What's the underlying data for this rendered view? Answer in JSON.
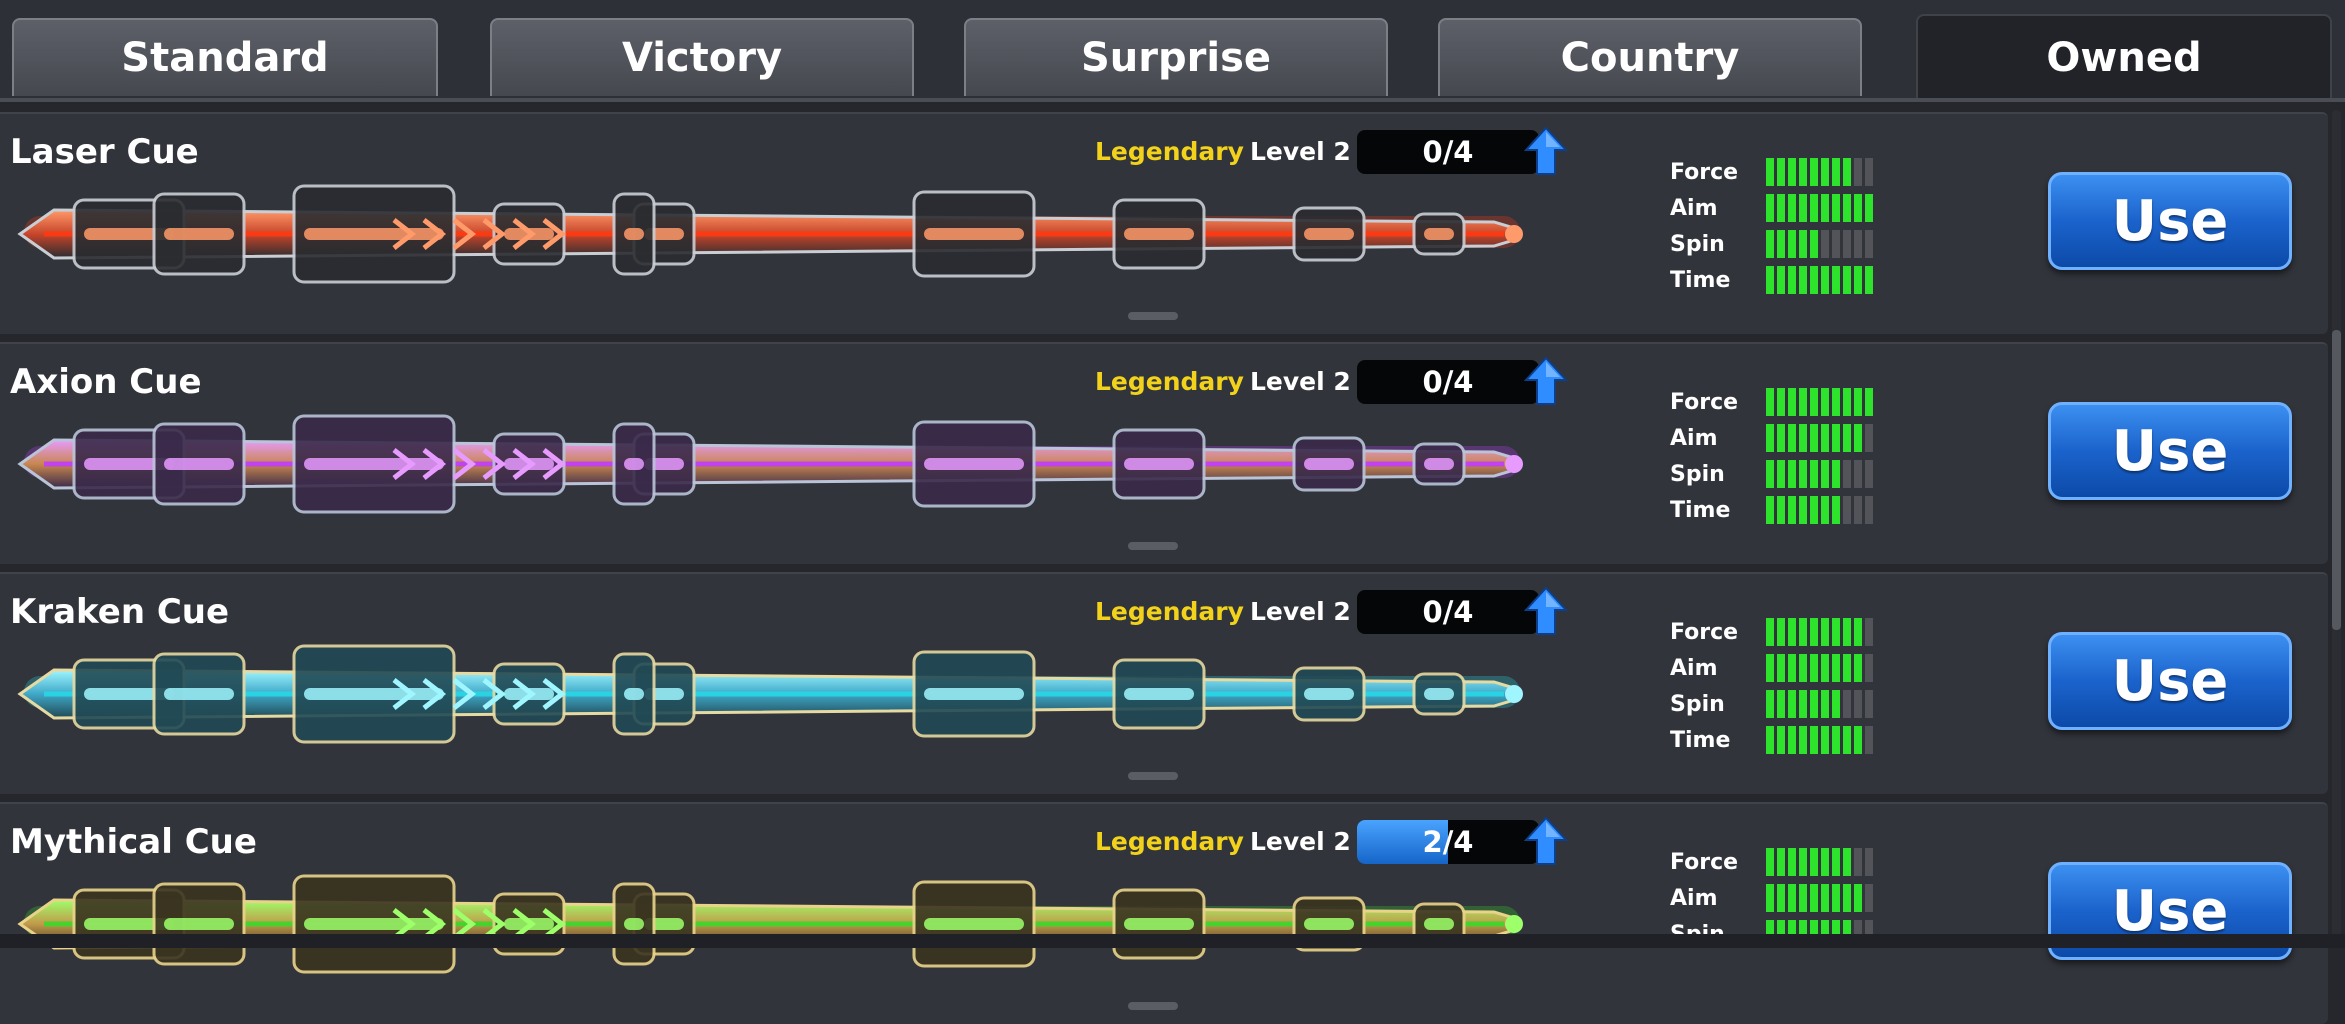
{
  "tabs": [
    {
      "label": "Standard"
    },
    {
      "label": "Victory"
    },
    {
      "label": "Surprise"
    },
    {
      "label": "Country"
    },
    {
      "label": "Owned",
      "active": true
    }
  ],
  "stat_labels": [
    "Force",
    "Aim",
    "Spin",
    "Time"
  ],
  "cues": [
    {
      "name": "Laser Cue",
      "rarity": "Legendary",
      "level": "Level 2",
      "progress": "0/4",
      "progress_fraction": 0.0,
      "stats": {
        "Force": 8,
        "Aim": 10,
        "Spin": 5,
        "Time": 10
      },
      "use_label": "Use",
      "theme": "red"
    },
    {
      "name": "Axion Cue",
      "rarity": "Legendary",
      "level": "Level 2",
      "progress": "0/4",
      "progress_fraction": 0.0,
      "stats": {
        "Force": 10,
        "Aim": 9,
        "Spin": 7,
        "Time": 7
      },
      "use_label": "Use",
      "theme": "purple"
    },
    {
      "name": "Kraken Cue",
      "rarity": "Legendary",
      "level": "Level 2",
      "progress": "0/4",
      "progress_fraction": 0.0,
      "stats": {
        "Force": 9,
        "Aim": 9,
        "Spin": 7,
        "Time": 9
      },
      "use_label": "Use",
      "theme": "teal"
    },
    {
      "name": "Mythical Cue",
      "rarity": "Legendary",
      "level": "Level 2",
      "progress": "2/4",
      "progress_fraction": 0.5,
      "stats": {
        "Force": 8,
        "Aim": 9,
        "Spin": 8
      },
      "use_label": "Use",
      "theme": "green"
    }
  ],
  "colors": {
    "rarity": "#f2d21b",
    "stat_on": "#2ee32b",
    "stat_off": "#525459",
    "use_button": "#1b63cc"
  },
  "icons": [
    "upgrade-arrow-icon"
  ]
}
